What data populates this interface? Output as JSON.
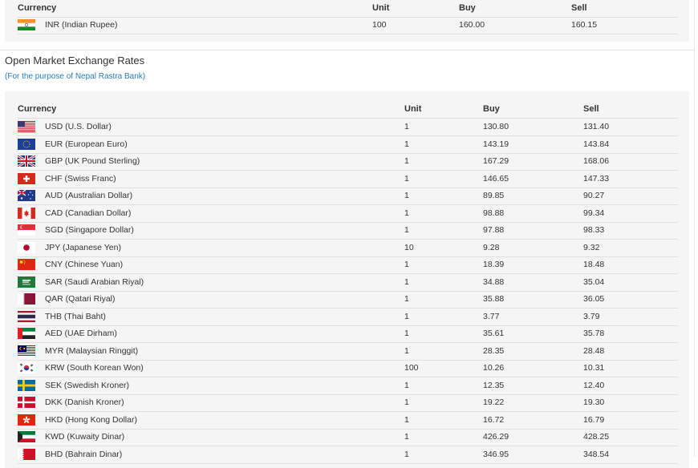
{
  "top_table": {
    "headers": {
      "currency": "Currency",
      "unit": "Unit",
      "buy": "Buy",
      "sell": "Sell"
    },
    "rows": [
      {
        "flag": "india-flag",
        "currency": "INR (Indian Rupee)",
        "unit": "100",
        "buy": "160.00",
        "sell": "160.15"
      }
    ]
  },
  "section": {
    "title": "Open Market Exchange Rates",
    "subtitle": "(For the purpose of Nepal Rastra Bank)"
  },
  "main_table": {
    "headers": {
      "currency": "Currency",
      "unit": "Unit",
      "buy": "Buy",
      "sell": "Sell"
    },
    "rows": [
      {
        "flag": "usa-flag",
        "currency": "USD (U.S. Dollar)",
        "unit": "1",
        "buy": "130.80",
        "sell": "131.40"
      },
      {
        "flag": "eu-flag",
        "currency": "EUR (European Euro)",
        "unit": "1",
        "buy": "143.19",
        "sell": "143.84"
      },
      {
        "flag": "uk-flag",
        "currency": "GBP (UK Pound Sterling)",
        "unit": "1",
        "buy": "167.29",
        "sell": "168.06"
      },
      {
        "flag": "switzerland-flag",
        "currency": "CHF (Swiss Franc)",
        "unit": "1",
        "buy": "146.65",
        "sell": "147.33"
      },
      {
        "flag": "australia-flag",
        "currency": "AUD (Australian Dollar)",
        "unit": "1",
        "buy": "89.85",
        "sell": "90.27"
      },
      {
        "flag": "canada-flag",
        "currency": "CAD (Canadian Dollar)",
        "unit": "1",
        "buy": "98.88",
        "sell": "99.34"
      },
      {
        "flag": "singapore-flag",
        "currency": "SGD (Singapore Dollar)",
        "unit": "1",
        "buy": "97.88",
        "sell": "98.33"
      },
      {
        "flag": "japan-flag",
        "currency": "JPY (Japanese Yen)",
        "unit": "10",
        "buy": "9.28",
        "sell": "9.32"
      },
      {
        "flag": "china-flag",
        "currency": "CNY (Chinese Yuan)",
        "unit": "1",
        "buy": "18.39",
        "sell": "18.48"
      },
      {
        "flag": "saudi-arabia-flag",
        "currency": "SAR (Saudi Arabian Riyal)",
        "unit": "1",
        "buy": "34.88",
        "sell": "35.04"
      },
      {
        "flag": "qatar-flag",
        "currency": "QAR (Qatari Riyal)",
        "unit": "1",
        "buy": "35.88",
        "sell": "36.05"
      },
      {
        "flag": "thailand-flag",
        "currency": "THB (Thai Baht)",
        "unit": "1",
        "buy": "3.77",
        "sell": "3.79"
      },
      {
        "flag": "uae-flag",
        "currency": "AED (UAE Dirham)",
        "unit": "1",
        "buy": "35.61",
        "sell": "35.78"
      },
      {
        "flag": "malaysia-flag",
        "currency": "MYR (Malaysian Ringgit)",
        "unit": "1",
        "buy": "28.35",
        "sell": "28.48"
      },
      {
        "flag": "south-korea-flag",
        "currency": "KRW (South Korean Won)",
        "unit": "100",
        "buy": "10.26",
        "sell": "10.31"
      },
      {
        "flag": "sweden-flag",
        "currency": "SEK (Swedish Kroner)",
        "unit": "1",
        "buy": "12.35",
        "sell": "12.40"
      },
      {
        "flag": "denmark-flag",
        "currency": "DKK (Danish Kroner)",
        "unit": "1",
        "buy": "19.22",
        "sell": "19.30"
      },
      {
        "flag": "hong-kong-flag",
        "currency": "HKD (Hong Kong Dollar)",
        "unit": "1",
        "buy": "16.72",
        "sell": "16.79"
      },
      {
        "flag": "kuwait-flag",
        "currency": "KWD (Kuwaity Dinar)",
        "unit": "1",
        "buy": "426.29",
        "sell": "428.25"
      },
      {
        "flag": "bahrain-flag",
        "currency": "BHD (Bahrain Dinar)",
        "unit": "1",
        "buy": "346.95",
        "sell": "348.54"
      }
    ]
  }
}
